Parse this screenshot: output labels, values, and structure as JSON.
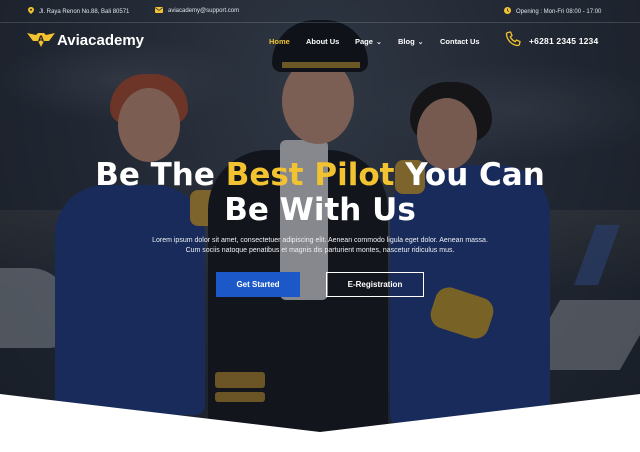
{
  "topbar": {
    "address": "Jl. Raya Renon No.88, Bali 80571",
    "email": "aviacademy@support.com",
    "hours": "Opening : Mon-Fri 08:00 - 17:00"
  },
  "brand": {
    "name": "Aviacademy",
    "accent_color": "#f2c230",
    "primary_color": "#1d58c8"
  },
  "nav": {
    "items": [
      {
        "label": "Home",
        "active": true
      },
      {
        "label": "About Us",
        "active": false
      },
      {
        "label": "Page",
        "active": false,
        "has_dropdown": true
      },
      {
        "label": "Blog",
        "active": false,
        "has_dropdown": true
      },
      {
        "label": "Contact Us",
        "active": false
      }
    ],
    "phone": "+6281 2345 1234"
  },
  "hero": {
    "headline_part1": "Be The ",
    "headline_accent": "Best Pilot",
    "headline_part2": " You Can",
    "headline_line2": "Be With Us",
    "subtext_line1": "Lorem ipsum dolor sit amet, consectetuer adipiscing elit. Aenean commodo ligula eget dolor. Aenean massa.",
    "subtext_line2": "Cum sociis natoque penatibus et magnis dis parturient montes, nascetur ridiculus mus.",
    "primary_button": "Get Started",
    "secondary_button": "E-Registration"
  },
  "icons": {
    "address": "map-pin-icon",
    "email": "mail-icon",
    "hours": "clock-icon",
    "phone": "phone-icon",
    "logo": "aviation-wings-logo"
  }
}
